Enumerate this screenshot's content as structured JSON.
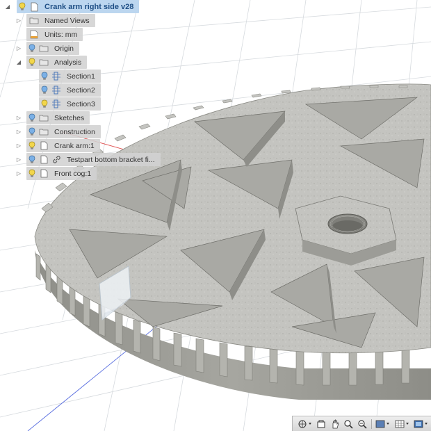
{
  "browser": {
    "root": {
      "label": "Crank arm right side v28"
    },
    "items": [
      {
        "label": "Named Views",
        "icon": "folder-icon",
        "bulb": false,
        "caret": "right"
      },
      {
        "label": "Units: mm",
        "icon": "units-icon",
        "bulb": false,
        "caret": "none"
      },
      {
        "label": "Origin",
        "icon": "folder-icon",
        "bulb": true,
        "caret": "right"
      },
      {
        "label": "Analysis",
        "icon": "folder-icon",
        "bulb": true,
        "caret": "down"
      },
      {
        "label": "Section1",
        "icon": "section-icon",
        "bulb": true,
        "caret": "none"
      },
      {
        "label": "Section2",
        "icon": "section-icon",
        "bulb": true,
        "caret": "none"
      },
      {
        "label": "Section3",
        "icon": "section-icon",
        "bulb": true,
        "caret": "none"
      },
      {
        "label": "Sketches",
        "icon": "folder-icon",
        "bulb": true,
        "caret": "right"
      },
      {
        "label": "Construction",
        "icon": "folder-icon",
        "bulb": true,
        "caret": "right"
      },
      {
        "label": "Crank arm:1",
        "icon": "component-icon",
        "bulb": true,
        "caret": "right"
      },
      {
        "label": "Testpart bottom bracket fi...",
        "icon": "component-icon",
        "bulb": true,
        "caret": "right",
        "linked": true
      },
      {
        "label": "Front cog:1",
        "icon": "component-icon",
        "bulb": true,
        "caret": "right"
      }
    ]
  },
  "colors": {
    "bulb_on": "#f2d64b",
    "bulb_blue": "#7bb0e6",
    "part_gray": "#9a9a94",
    "part_top": "#c2c2be",
    "grid": "#d9dde2",
    "axis_red": "#e05050",
    "axis_blue": "#5a6fe0"
  },
  "toolbar": {
    "buttons": [
      "orbit-icon",
      "look-at-icon",
      "pan-icon",
      "zoom-icon",
      "fit-icon",
      "display-style-icon",
      "visual-style-icon",
      "grid-icon"
    ]
  }
}
